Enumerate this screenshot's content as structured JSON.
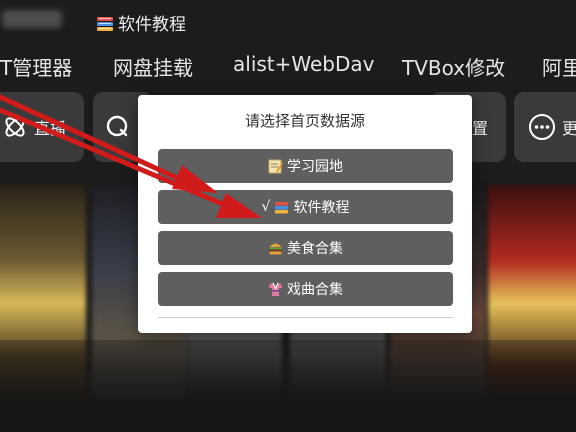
{
  "header": {
    "blurred_text": "",
    "title_icon": "books-icon",
    "title": "软件教程"
  },
  "tabs": [
    {
      "label": "T管理器"
    },
    {
      "label": "网盘挂载"
    },
    {
      "label": "alist+WebDav"
    },
    {
      "label": "TVBox修改"
    },
    {
      "label": "阿里"
    }
  ],
  "chips": [
    {
      "icon": "atom-icon",
      "label": "直播"
    },
    {
      "icon": "search-icon",
      "label": ""
    },
    {
      "icon": "",
      "label": "置"
    },
    {
      "icon": "more-icon",
      "label": "更"
    }
  ],
  "dialog": {
    "title": "请选择首页数据源",
    "options": [
      {
        "icon": "memo-icon",
        "label": "学习园地",
        "selected": false,
        "prefix": ""
      },
      {
        "icon": "books-icon",
        "label": "软件教程",
        "selected": true,
        "prefix": "√"
      },
      {
        "icon": "burger-icon",
        "label": "美食合集",
        "selected": false,
        "prefix": ""
      },
      {
        "icon": "kimono-icon",
        "label": "戏曲合集",
        "selected": false,
        "prefix": ""
      }
    ]
  },
  "colors": {
    "arrow": "#d11a1a",
    "dialog_bg": "#ffffff",
    "option_bg": "#5f5f5f",
    "chip_bg": "#3a3a3a"
  }
}
